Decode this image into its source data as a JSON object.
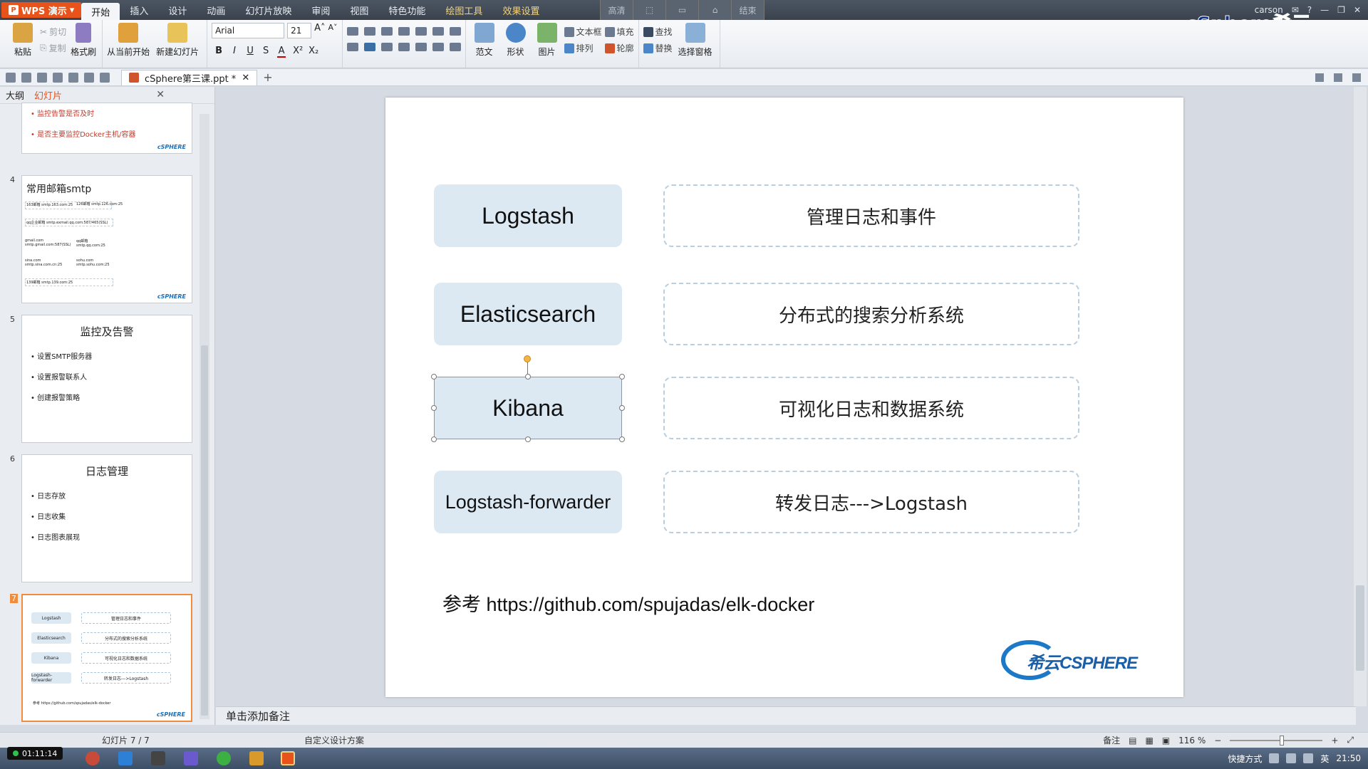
{
  "app": {
    "name": "WPS 演示",
    "user": "carson",
    "watermark": "cSphere希云"
  },
  "menu": {
    "tabs": [
      "开始",
      "插入",
      "设计",
      "动画",
      "幻灯片放映",
      "审阅",
      "视图",
      "特色功能"
    ],
    "context_tabs": [
      "绘图工具",
      "效果设置"
    ],
    "slideshow": [
      "高清",
      "",
      "",
      "",
      "结束"
    ]
  },
  "ribbon": {
    "paste": "粘贴",
    "cut": "剪切",
    "copy": "复制",
    "format_painter": "格式刷",
    "from_current": "从当前开始",
    "new_slide": "新建幻灯片",
    "font_name": "Arial",
    "font_size": "21",
    "bold": "B",
    "italic": "I",
    "underline": "U",
    "shadow": "S",
    "fontcolor": "A",
    "superscript": "X²",
    "subscript": "X₂",
    "template": "范文",
    "shape": "形状",
    "picture": "图片",
    "textbox": "文本框",
    "arrange": "排列",
    "fill": "填充",
    "outline": "轮廓",
    "find": "查找",
    "replace": "替换",
    "select_pane": "选择窗格"
  },
  "document": {
    "tab": "cSphere第三课.ppt *"
  },
  "left_panel": {
    "tabs": [
      "大纲",
      "幻灯片"
    ],
    "slides": [
      {
        "num": "",
        "bullets": [
          "监控告警是否及时",
          "是否主要监控Docker主机/容器"
        ]
      },
      {
        "num": "4",
        "title": "常用邮箱smtp",
        "lines": [
          "163邮箱 smtp.163.com:25",
          "126邮箱 smtp.126.com:25",
          "qq企业邮箱 smtp.exmail.qq.com:587/465(SSL)",
          "gmail.com smtp.gmail.com:587(SSL)",
          "qq邮箱 smtp.qq.com:25",
          "sina.com smtp.sina.com.cn:25",
          "sohu.com smtp.sohu.com:25",
          "139邮箱 smtp.139.com:25"
        ]
      },
      {
        "num": "5",
        "title": "监控及告警",
        "bullets": [
          "设置SMTP服务器",
          "设置报警联系人",
          "创建报警策略"
        ]
      },
      {
        "num": "6",
        "title": "日志管理",
        "bullets": [
          "日志存放",
          "日志收集",
          "日志图表展现"
        ]
      },
      {
        "num": "7"
      }
    ],
    "thumb_logo": "cSPHERE"
  },
  "slide": {
    "rows": [
      {
        "name": "Logstash",
        "desc": "管理日志和事件"
      },
      {
        "name": "Elasticsearch",
        "desc": "分布式的搜索分析系统"
      },
      {
        "name": "Kibana",
        "desc": "可视化日志和数据系统"
      },
      {
        "name": "Logstash-forwarder",
        "desc": "转发日志--->Logstash"
      }
    ],
    "reference": "参考 https://github.com/spujadas/elk-docker",
    "logo_text": "希云CSPHERE"
  },
  "notes_placeholder": "单击添加备注",
  "status": {
    "slide_counter": "幻灯片 7 / 7",
    "design": "自定义设计方案",
    "notes_btn": "备注",
    "zoom": "116 %"
  },
  "taskbar": {
    "rec_time": "01:11:14",
    "ime": "快捷方式",
    "lang": "英",
    "clock": "21:50"
  }
}
